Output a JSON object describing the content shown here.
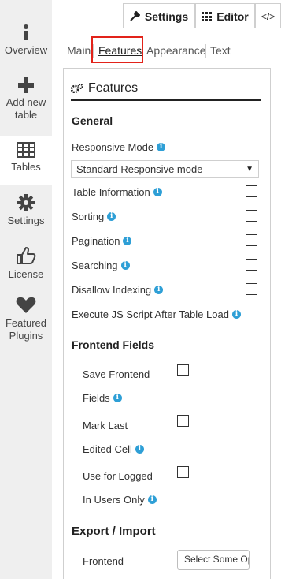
{
  "sidebar": {
    "items": [
      {
        "label": "Overview",
        "icon": "info-icon"
      },
      {
        "label": "Add new table",
        "icon": "plus-icon"
      },
      {
        "label": "Tables",
        "icon": "table-icon"
      },
      {
        "label": "Settings",
        "icon": "gear-icon"
      },
      {
        "label": "License",
        "icon": "thumbs-up-icon"
      },
      {
        "label": "Featured Plugins",
        "icon": "heart-icon"
      }
    ]
  },
  "top_tabs": [
    {
      "label": "Settings",
      "icon": "wrench-icon"
    },
    {
      "label": "Editor",
      "icon": "grid-icon"
    },
    {
      "label": "</>",
      "icon": "code-icon"
    }
  ],
  "subtabs": [
    "Main",
    "Features",
    "Appearance",
    "Text"
  ],
  "panel": {
    "title": "Features",
    "general_heading": "General",
    "responsive_mode_label": "Responsive Mode",
    "responsive_mode_value": "Standard Responsive mode",
    "options": [
      {
        "label": "Table Information",
        "checked": false
      },
      {
        "label": "Sorting",
        "checked": false
      },
      {
        "label": "Pagination",
        "checked": false
      },
      {
        "label": "Searching",
        "checked": false
      },
      {
        "label": "Disallow Indexing",
        "checked": false
      },
      {
        "label": "Execute JS Script After Table Load",
        "checked": false
      }
    ],
    "frontend_heading": "Frontend Fields",
    "frontend_options": [
      {
        "line1": "Save Frontend",
        "line2": "Fields",
        "checked": false
      },
      {
        "line1": "Mark Last",
        "line2": "Edited Cell",
        "checked": false
      },
      {
        "line1": "Use for Logged",
        "line2": "In Users Only",
        "checked": false
      }
    ],
    "export_heading": "Export / Import",
    "export_row_label": "Frontend",
    "export_select_placeholder": "Select Some Options"
  },
  "colors": {
    "highlight_box": "#e2231a",
    "info_icon": "#2e9fd6",
    "sidebar_bg": "#efefef"
  }
}
